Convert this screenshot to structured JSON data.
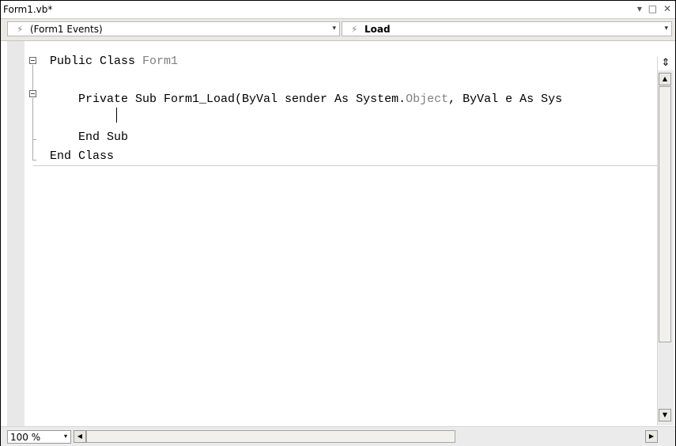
{
  "window": {
    "title": "Form1.vb*"
  },
  "title_controls": {
    "dropdown": "▾",
    "maximize": "□",
    "close": "✕"
  },
  "dropdowns": {
    "left": {
      "value": "(Form1 Events)",
      "icon": "lightning-bolt-icon"
    },
    "right": {
      "value": "Load",
      "icon": "lightning-bolt-icon"
    }
  },
  "code": {
    "lines": [
      {
        "parts": [
          {
            "t": "Public Class ",
            "c": "kw"
          },
          {
            "t": "Form1",
            "c": "ty"
          }
        ]
      },
      {
        "parts": [
          {
            "t": "",
            "c": "kw"
          }
        ]
      },
      {
        "parts": [
          {
            "t": "    Private Sub Form1_Load(ByVal sender As System.",
            "c": "kw"
          },
          {
            "t": "Object",
            "c": "ty"
          },
          {
            "t": ", ByVal e As Sys",
            "c": "kw"
          }
        ]
      },
      {
        "parts": [
          {
            "t": "",
            "c": "kw"
          }
        ]
      },
      {
        "parts": [
          {
            "t": "    End Sub",
            "c": "kw"
          }
        ]
      },
      {
        "parts": [
          {
            "t": "End Class",
            "c": "kw"
          }
        ]
      }
    ]
  },
  "zoom": {
    "value": "100 %"
  },
  "icons": {
    "splitter": "⇕",
    "scroll_up": "▲",
    "scroll_down": "▼",
    "scroll_left": "◀",
    "scroll_right": "▶",
    "dropdown_arrow": "▾",
    "bolt": "⚡"
  }
}
